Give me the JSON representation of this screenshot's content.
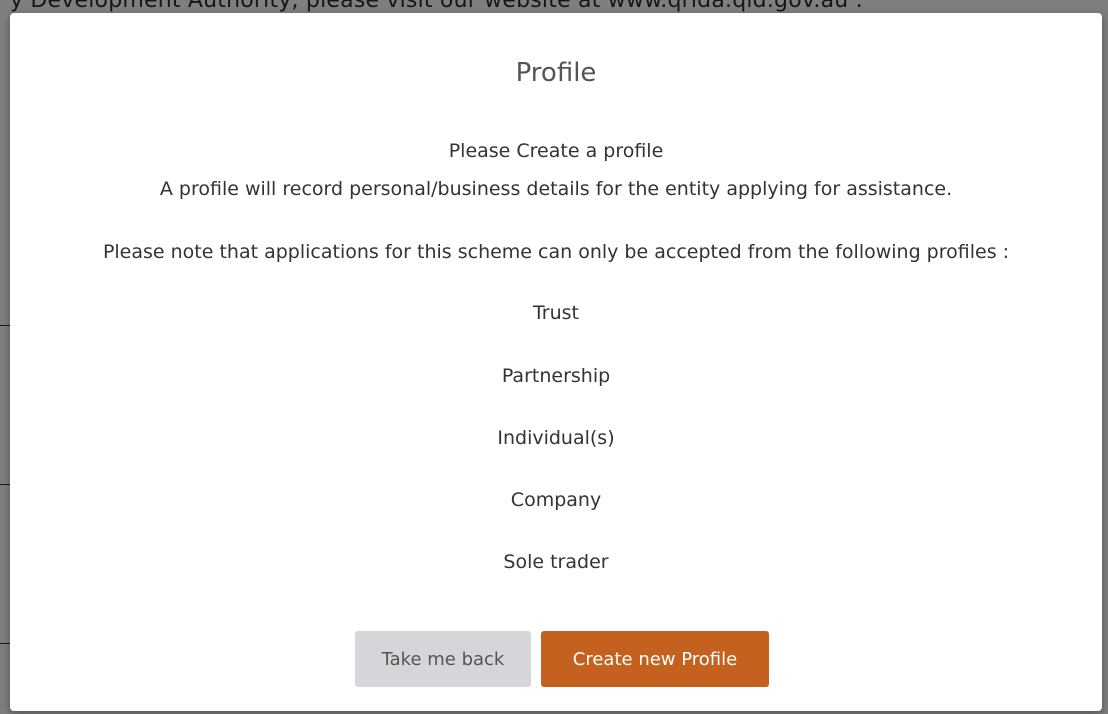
{
  "background": {
    "partial_text": "y Development Authority, please visit our website at www.qrida.qld.gov.au ."
  },
  "modal": {
    "title": "Profile",
    "intro_heading": "Please Create a profile",
    "intro_text": "A profile will record personal/business details for the entity applying for assistance.",
    "note": "Please note that applications for this scheme can only be accepted from the following profiles :",
    "profiles": [
      "Trust",
      "Partnership",
      "Individual(s)",
      "Company",
      "Sole trader"
    ]
  },
  "buttons": {
    "back_label": "Take me back",
    "create_label": "Create new Profile"
  },
  "colors": {
    "primary_button": "#c4611f",
    "secondary_button": "#d4d6d9",
    "overlay": "#7d7d7d"
  }
}
